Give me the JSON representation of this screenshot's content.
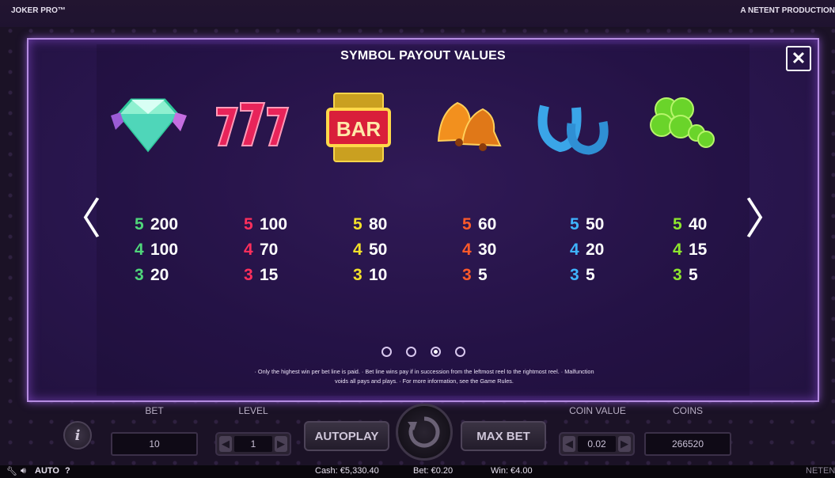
{
  "window": {
    "game_title": "JOKER PRO™",
    "producer": "A NETENT PRODUCTION"
  },
  "paytable": {
    "title": "SYMBOL PAYOUT VALUES",
    "close_label": "✕",
    "prev_label": "〈",
    "next_label": "〉",
    "symbols": [
      {
        "name": "diamond",
        "color": "#4fd67a",
        "pays": [
          {
            "count": "5",
            "value": "200"
          },
          {
            "count": "4",
            "value": "100"
          },
          {
            "count": "3",
            "value": "20"
          }
        ]
      },
      {
        "name": "sevens",
        "color": "#ff2f5c",
        "pays": [
          {
            "count": "5",
            "value": "100"
          },
          {
            "count": "4",
            "value": "70"
          },
          {
            "count": "3",
            "value": "15"
          }
        ]
      },
      {
        "name": "bar",
        "color": "#f3e12a",
        "pays": [
          {
            "count": "5",
            "value": "80"
          },
          {
            "count": "4",
            "value": "50"
          },
          {
            "count": "3",
            "value": "10"
          }
        ]
      },
      {
        "name": "bell",
        "color": "#ff5a2a",
        "pays": [
          {
            "count": "5",
            "value": "60"
          },
          {
            "count": "4",
            "value": "30"
          },
          {
            "count": "3",
            "value": "5"
          }
        ]
      },
      {
        "name": "horseshoe",
        "color": "#3fb4ff",
        "pays": [
          {
            "count": "5",
            "value": "50"
          },
          {
            "count": "4",
            "value": "20"
          },
          {
            "count": "3",
            "value": "5"
          }
        ]
      },
      {
        "name": "clover",
        "color": "#8ee62e",
        "pays": [
          {
            "count": "5",
            "value": "40"
          },
          {
            "count": "4",
            "value": "15"
          },
          {
            "count": "3",
            "value": "5"
          }
        ]
      }
    ],
    "bar_symbol_text": "BAR",
    "pages": 4,
    "active_page": 3,
    "rules_line1": "· Only the highest win per bet line is paid. · Bet line wins pay if in succession from the leftmost reel to the rightmost reel. · Malfunction",
    "rules_line2": "voids all pays and plays. · For more information, see the Game Rules."
  },
  "controls": {
    "bet_label": "BET",
    "bet_value": "10",
    "level_label": "LEVEL",
    "level_value": "1",
    "autoplay_label": "AUTOPLAY",
    "maxbet_label": "MAX BET",
    "coin_value_label": "COIN VALUE",
    "coin_value": "0.02",
    "coins_label": "COINS",
    "coins_value": "266520",
    "info_label": "i"
  },
  "status": {
    "auto_label": "AUTO",
    "help_label": "?",
    "cash": "Cash: €5,330.40",
    "bet": "Bet: €0.20",
    "win": "Win: €4.00",
    "brand": "NETENT"
  }
}
